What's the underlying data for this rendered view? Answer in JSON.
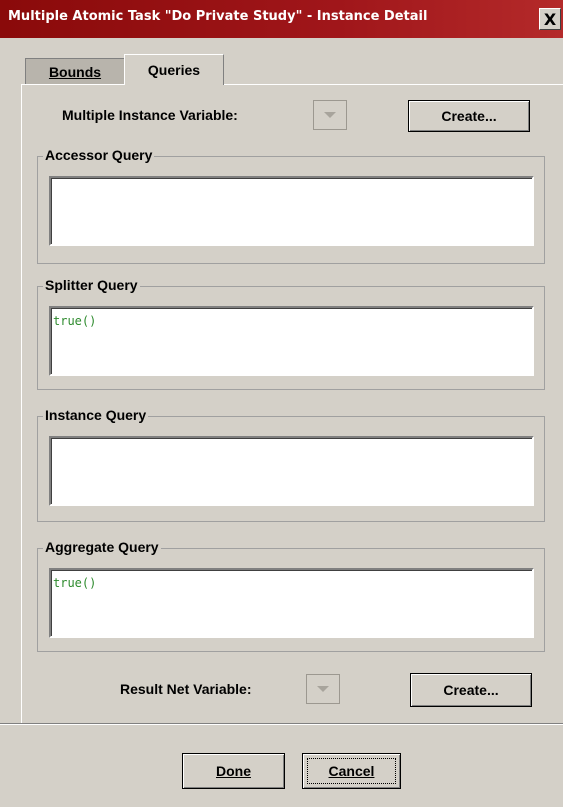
{
  "window": {
    "title": "Multiple Atomic Task \"Do Private Study\" - Instance Detail",
    "close_label": "X"
  },
  "tabs": [
    {
      "label": "Bounds"
    },
    {
      "label": "Queries"
    }
  ],
  "multiple_instance": {
    "label": "Multiple Instance Variable:",
    "create_label": "Create..."
  },
  "groups": {
    "accessor": {
      "title": "Accessor Query",
      "value": ""
    },
    "splitter": {
      "title": "Splitter Query",
      "value": "true()"
    },
    "instance": {
      "title": "Instance Query",
      "value": ""
    },
    "aggregate": {
      "title": "Aggregate Query",
      "value": "true()"
    }
  },
  "result_net": {
    "label": "Result Net Variable:",
    "create_label": "Create..."
  },
  "footer": {
    "done_label": "Done",
    "cancel_label": "Cancel"
  },
  "colors": {
    "titlebar": "#a0161a",
    "dialog_bg": "#d4d0c8",
    "query_text": "#2e8b2e"
  }
}
